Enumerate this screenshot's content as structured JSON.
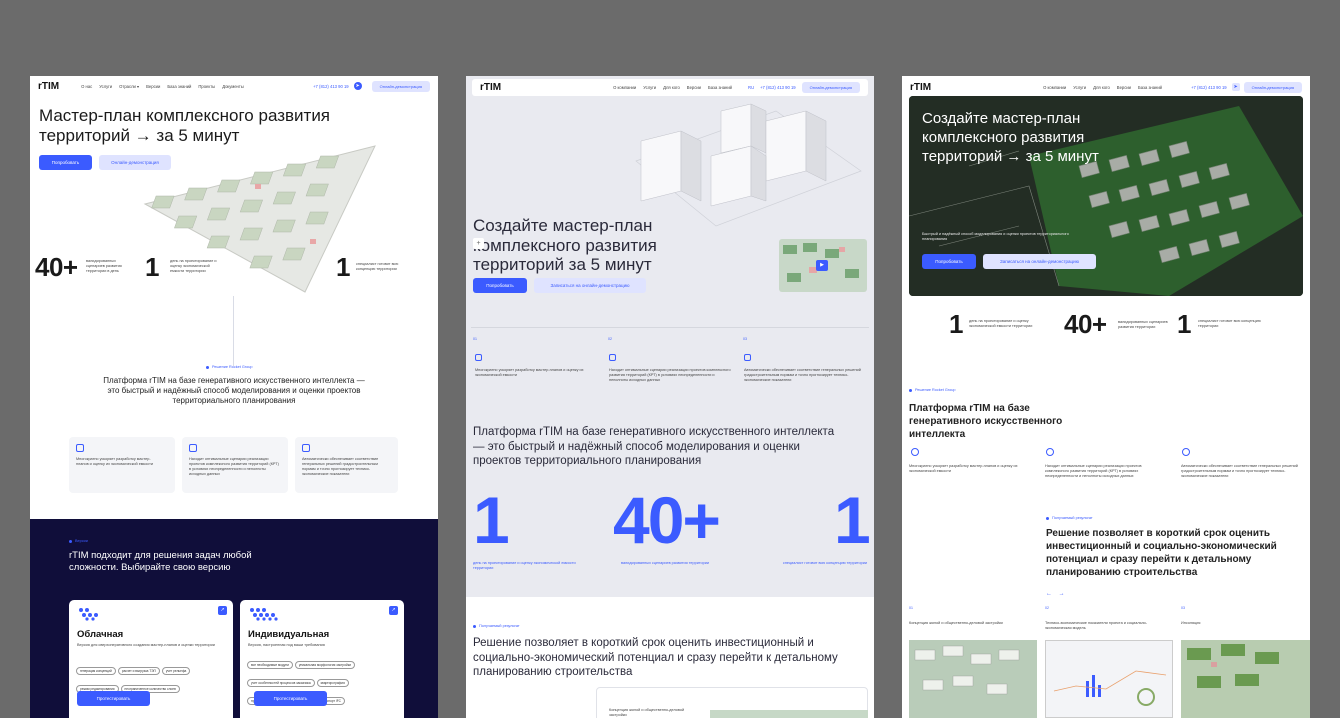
{
  "sheet1": {
    "logo": "rTIM",
    "nav": [
      "О нас",
      "Услуги",
      "Отрасли ▾",
      "Версии",
      "База знаний",
      "Проекты",
      "Документы"
    ],
    "phone": "+7 (812) 413 90 19",
    "nav_button": "Онлайн-демонстрация",
    "title": "Мастер-план комплексного развития территорий → за 5 минут",
    "try_btn": "Попробовать",
    "demo_btn": "Онлайн-демонстрация",
    "stats": [
      {
        "num": "40+",
        "text": "валидированных сценариев развития территории в день"
      },
      {
        "num": "1",
        "text": "день на проектирование и оценку экономической емкости территории"
      },
      {
        "num": "1",
        "text": "специалист готовит всю концепцию территории"
      }
    ],
    "tag": "Решение Rocket Group",
    "platform": "Платформа rTIM на базе генеративного искусственного интеллекта — это быстрый и надёжный способ моделирования и оценки проектов территориального планирования",
    "features": [
      "Многократно ускоряет разработку мастер-планов и оценку их экономической емкости",
      "Находит оптимальные сценарии реализации проектов комплексного развития территорий (КРТ) в условиях неопределенности и неполноты исходных данных",
      "Автоматически обеспечивает соответствие генеральных решений градостроительным нормам и точно прогнозирует технико-экономические показатели"
    ],
    "dark_tag": "Версии",
    "dark_title": "rTIM подходит для решения задач любой сложности. Выбирайте свою версию",
    "cards": [
      {
        "title": "Облачная",
        "desc": "Версия для сверхоперативного создания мастер-планов и оценки территории",
        "chips": [
          "генерация концепций",
          "расчет и выгрузка ТЭП",
          "учет рельефа",
          "режим редактирования",
          "неограниченное количество слоев"
        ],
        "btn": "Протестировать"
      },
      {
        "title": "Индивидуальная",
        "desc": "Версия, настроенная под ваши требования",
        "chips": [
          "все необходимые модули",
          "уникальная морфология застройки",
          "учет особенностей процессов заказчика",
          "квартирография",
          "продвинутая архитектурная визуализация",
          "экспорт IFC"
        ],
        "btn": "Протестировать"
      }
    ]
  },
  "sheet2": {
    "logo": "rTIM",
    "nav": [
      "О компании",
      "Услуги",
      "Для кого",
      "Версии",
      "База знаний"
    ],
    "lang": "RU",
    "phone": "+7 (812) 413 90 19",
    "nav_button": "Онлайн-демонстрация",
    "title": "Создайте мастер-план комплексного развития территорий за 5 минут",
    "plus": "+",
    "try_btn": "Попробовать",
    "demo_btn": "Записаться на онлайн-демонстрацию",
    "cols": [
      {
        "n": "01",
        "text": "Многократно ускоряет разработку мастер-планов и оценку их экономической емкости"
      },
      {
        "n": "02",
        "text": "Находит оптимальные сценарии реализации проектов комплексного развития территорий (КРТ) в условиях неопределенности и неполноты исходных данных"
      },
      {
        "n": "03",
        "text": "Автоматически обеспечивает соответствие генеральных решений градостроительным нормам и точно прогнозирует технико-экономические показатели"
      }
    ],
    "platform": "Платформа rTIM на базе генеративного искусственного интеллекта — это быстрый и надёжный способ моделирования и оценки проектов территориального планирования",
    "stats": [
      {
        "num": "1",
        "text": "день на проектирование и оценку экономической емкости территории"
      },
      {
        "num": "40+",
        "text": "валидированных сценариев развития территории"
      },
      {
        "num": "1",
        "text": "специалист готовит всю концепцию территории"
      }
    ],
    "tag": "Получаемый результат",
    "result": "Решение позволяет в короткий срок оценить инвестиционный и социально-экономический потенциал и сразу перейти к детальному планированию строительства",
    "bottom": "Концепция жилой и общественно-деловой застройки"
  },
  "sheet3": {
    "logo": "rTIM",
    "nav": [
      "О компании",
      "Услуги",
      "Для кого",
      "Версии",
      "База знаний"
    ],
    "phone": "+7 (812) 413 90 19",
    "nav_button": "Онлайн-демонстрация",
    "title": "Создайте мастер-план комплексного развития территорий → за 5 минут",
    "sub": "Быстрый и надёжный способ моделирования и оценки проектов территориального планирования",
    "try_btn": "Попробовать",
    "demo_btn": "Записаться на онлайн-демонстрацию",
    "stats": [
      {
        "num": "1",
        "text": "день на проектирование и оценку экономической емкости территории"
      },
      {
        "num": "40+",
        "text": "валидированных сценариев развития территории"
      },
      {
        "num": "1",
        "text": "специалист готовит всю концепцию территории"
      }
    ],
    "tag": "Решение Rocket Group",
    "platform": "Платформа rTIM на базе генеративного искусственного интеллекта",
    "features": [
      "Многократно ускоряет разработку мастер-планов и оценку их экономической емкости",
      "Находит оптимальные сценарии реализации проектов комплексного развития территорий (КРТ) в условиях неопределенности и неполноты исходных данных",
      "Автоматически обеспечивает соответствие генеральных решений градостроительным нормам и точно прогнозирует технико-экономические показатели"
    ],
    "tag2": "Получаемый результат",
    "result": "Решение позволяет в короткий срок оценить инвестиционный и социально-экономический потенциал и сразу перейти к детальному планированию строительства",
    "gallery": [
      {
        "n": "01",
        "label": "Концепция жилой и общественно-деловой застройки"
      },
      {
        "n": "02",
        "label": "Технико-экономические показатели проекта и социально-экономическая модель"
      },
      {
        "n": "03",
        "label": "Инсоляция"
      }
    ]
  }
}
